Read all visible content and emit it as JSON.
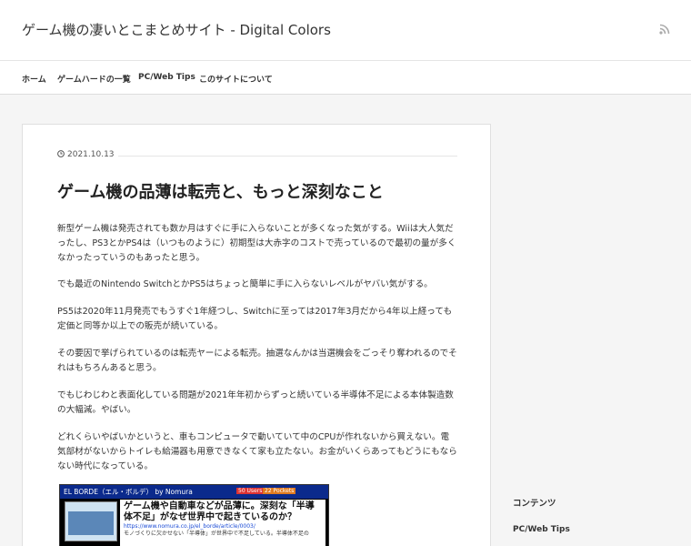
{
  "header": {
    "site_title": "ゲーム機の凄いとこまとめサイト - Digital Colors",
    "rss_icon": "rss-icon"
  },
  "nav": {
    "items": [
      {
        "label": "ホーム"
      },
      {
        "label": "ゲームハードの一覧"
      },
      {
        "label": "PC/Web Tips"
      },
      {
        "label": "このサイトについて"
      }
    ]
  },
  "article": {
    "date": "2021.10.13",
    "title": "ゲーム機の品薄は転売と、もっと深刻なこと",
    "paragraphs": [
      "新型ゲーム機は発売されても数か月はすぐに手に入らないことが多くなった気がする。Wiiは大人気だったし、PS3とかPS4は（いつものように）初期型は大赤字のコストで売っているので最初の量が多くなかったっていうのもあったと思う。",
      "でも最近のNintendo SwitchとかPS5はちょっと簡単に手に入らないレベルがヤバい気がする。",
      "PS5は2020年11月発売でもうすぐ1年経つし、Switchに至っては2017年3月だから4年以上経っても定価と同等か以上での販売が続いている。",
      "その要因で挙げられているのは転売ヤーによる転売。抽選なんかは当選機会をごっそり奪われるのでそれはもちろんあると思う。",
      "でもじわじわと表面化している問題が2021年年初からずっと続いている半導体不足による本体製造数の大幅減。やばい。",
      "どれくらいやばいかというと、車もコンピュータで動いていて中のCPUが作れないから買えない。電気部材がないからトイレも給湯器も用意できなくて家も立たない。お金がいくらあってもどうにもならない時代になっている。"
    ],
    "embed": {
      "brand": "EL BORDE（エル・ボルデ） by Nomura",
      "badge_users": "50 Users",
      "badge_pockets": "22 Pockets",
      "title": "ゲーム機や自動車などが品薄に。深刻な「半導体不足」がなぜ世界中で起きているのか？",
      "url": "https://www.nomura.co.jp/el_borde/article/0003/",
      "description": "モノづくりに欠かせない「半導体」が世界中で不足している。半導体不足の"
    }
  },
  "sidebar": {
    "heading": "コンテンツ",
    "link": "PC/Web Tips"
  }
}
